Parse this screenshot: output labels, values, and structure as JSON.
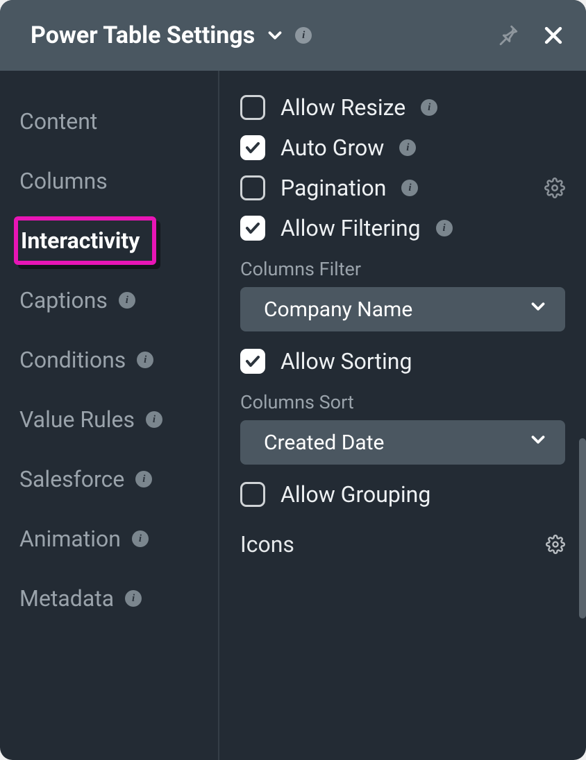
{
  "header": {
    "title": "Power Table Settings"
  },
  "sidebar": {
    "items": [
      {
        "label": "Content",
        "has_info": false,
        "active": false
      },
      {
        "label": "Columns",
        "has_info": false,
        "active": false
      },
      {
        "label": "Interactivity",
        "has_info": false,
        "active": true
      },
      {
        "label": "Captions",
        "has_info": true,
        "active": false
      },
      {
        "label": "Conditions",
        "has_info": true,
        "active": false
      },
      {
        "label": "Value Rules",
        "has_info": true,
        "active": false
      },
      {
        "label": "Salesforce",
        "has_info": true,
        "active": false
      },
      {
        "label": "Animation",
        "has_info": true,
        "active": false
      },
      {
        "label": "Metadata",
        "has_info": true,
        "active": false
      }
    ]
  },
  "settings": {
    "allow_resize": {
      "label": "Allow Resize",
      "checked": false,
      "has_info": true,
      "has_gear": false
    },
    "auto_grow": {
      "label": "Auto Grow",
      "checked": true,
      "has_info": true,
      "has_gear": false
    },
    "pagination": {
      "label": "Pagination",
      "checked": false,
      "has_info": true,
      "has_gear": true
    },
    "allow_filtering": {
      "label": "Allow Filtering",
      "checked": true,
      "has_info": true,
      "has_gear": false
    },
    "columns_filter_label": "Columns Filter",
    "columns_filter_value": "Company Name",
    "allow_sorting": {
      "label": "Allow Sorting",
      "checked": true,
      "has_info": false,
      "has_gear": false
    },
    "columns_sort_label": "Columns Sort",
    "columns_sort_value": "Created Date",
    "allow_grouping": {
      "label": "Allow Grouping",
      "checked": false,
      "has_info": false,
      "has_gear": false
    },
    "icons_label": "Icons"
  },
  "info_glyph": "i"
}
